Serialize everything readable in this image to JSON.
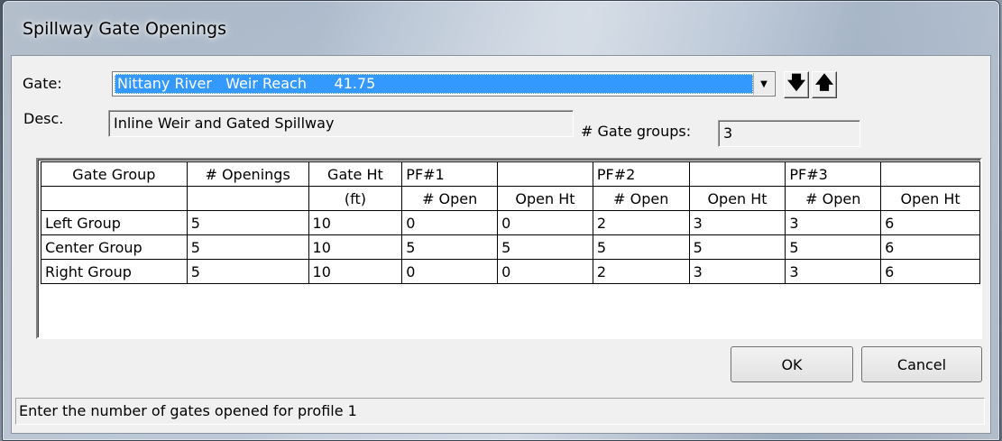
{
  "window": {
    "title": "Spillway Gate Openings"
  },
  "form": {
    "gate_label": "Gate:",
    "gate_value": "Nittany River   Weir Reach      41.75",
    "desc_label": "Desc.",
    "desc_value": "Inline Weir and Gated Spillway",
    "groups_label": "# Gate groups:",
    "groups_value": "3"
  },
  "grid": {
    "header1": [
      "Gate Group",
      "# Openings",
      "Gate Ht",
      "PF#1",
      "",
      "PF#2",
      "",
      "PF#3",
      ""
    ],
    "header2": [
      "",
      "",
      "(ft)",
      "# Open",
      "Open Ht",
      "# Open",
      "Open Ht",
      "# Open",
      "Open Ht"
    ],
    "rows": [
      [
        "Left Group",
        "5",
        "10",
        "0",
        "0",
        "2",
        "3",
        "3",
        "6"
      ],
      [
        "Center Group",
        "5",
        "10",
        "5",
        "5",
        "5",
        "5",
        "5",
        "6"
      ],
      [
        "Right Group",
        "5",
        "10",
        "0",
        "0",
        "2",
        "3",
        "3",
        "6"
      ]
    ]
  },
  "buttons": {
    "ok": "OK",
    "cancel": "Cancel"
  },
  "status": "Enter the number of gates opened for profile 1"
}
